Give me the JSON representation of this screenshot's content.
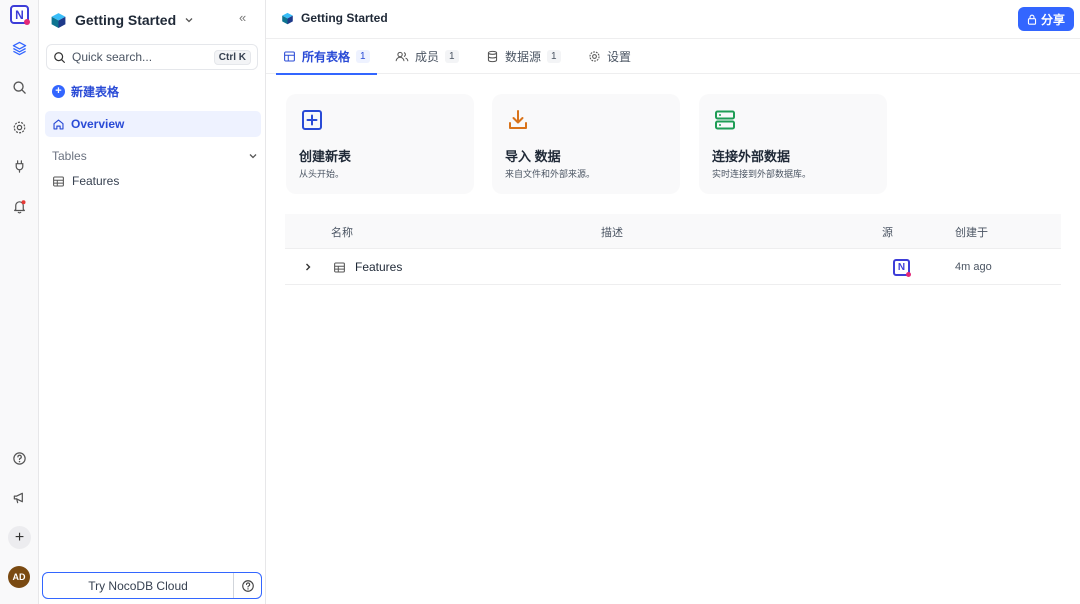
{
  "rail": {
    "logo": "N",
    "avatar": "AD"
  },
  "sidebar": {
    "workspace_title": "Getting Started",
    "search_placeholder": "Quick search...",
    "search_shortcut": "Ctrl K",
    "new_table_label": "新建表格",
    "overview_label": "Overview",
    "tables_header": "Tables",
    "tables": [
      {
        "label": "Features"
      }
    ],
    "try_cloud_label": "Try NocoDB Cloud"
  },
  "header": {
    "title": "Getting Started",
    "share_label": "分享"
  },
  "tabs": [
    {
      "label": "所有表格",
      "count": "1",
      "active": true
    },
    {
      "label": "成员",
      "count": "1"
    },
    {
      "label": "数据源",
      "count": "1"
    },
    {
      "label": "设置"
    }
  ],
  "cards": [
    {
      "title": "创建新表",
      "subtitle": "从头开始。",
      "icon": "plus-square-icon",
      "color": "#2a4bd6"
    },
    {
      "title": "导入 数据",
      "subtitle": "来自文件和外部来源。",
      "icon": "download-icon",
      "color": "#d9731a"
    },
    {
      "title": "连接外部数据",
      "subtitle": "实时连接到外部数据库。",
      "icon": "server-icon",
      "color": "#1f9d55"
    }
  ],
  "table": {
    "columns": {
      "name": "名称",
      "description": "描述",
      "source": "源",
      "created": "创建于"
    },
    "rows": [
      {
        "name": "Features",
        "source_icon": "N",
        "created": "4m ago"
      }
    ]
  }
}
